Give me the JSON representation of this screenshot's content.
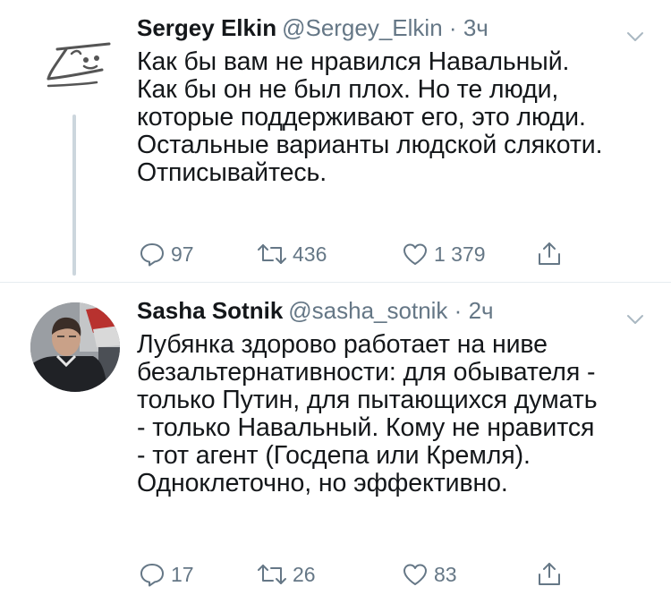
{
  "tweets": [
    {
      "author_name": "Sergey Elkin",
      "handle": "@Sergey_Elkin",
      "time": "3ч",
      "lines": [
        "Как бы вам не нравился Навальный.",
        "Как бы он не был плох. Но те люди,",
        "которые поддерживают его, это люди.",
        "Остальные варианты людской слякоти.",
        "Отписывайтесь."
      ],
      "replies": "97",
      "retweets": "436",
      "likes": "1 379"
    },
    {
      "author_name": "Sasha Sotnik",
      "handle": "@sasha_sotnik",
      "time": "2ч",
      "lines": [
        "Лубянка здорово работает на ниве",
        "безальтернативности: для обывателя -",
        "только Путин, для пытающихся думать",
        "- только Навальный. Кому не нравится",
        "- тот агент (Госдепа или Кремля).",
        "Одноклеточно, но эффективно."
      ],
      "replies": "17",
      "retweets": "26",
      "likes": "83"
    }
  ],
  "separator": "·",
  "icons": {
    "reply": "reply-icon",
    "retweet": "retweet-icon",
    "like": "heart-icon",
    "share": "share-icon",
    "caret": "chevron-down-icon"
  },
  "colors": {
    "text": "#14171a",
    "secondary": "#657786",
    "thread_line": "#ccd6dd"
  }
}
